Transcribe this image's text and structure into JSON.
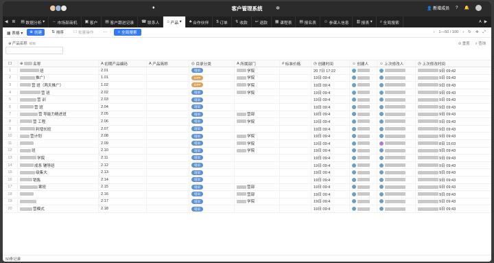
{
  "titlebar": {
    "title": "客户管理系统",
    "new_member": "新增成员"
  },
  "tabs": [
    {
      "label": "数据分析"
    },
    {
      "label": "市场部商机"
    },
    {
      "label": "客户"
    },
    {
      "label": "客户跟进记录"
    },
    {
      "label": "联系人"
    },
    {
      "label": "产品",
      "active": true
    },
    {
      "label": "合作伙伴"
    },
    {
      "label": "订单"
    },
    {
      "label": "收款"
    },
    {
      "label": "退款"
    },
    {
      "label": "课程表"
    },
    {
      "label": "报名表"
    },
    {
      "label": "参课人信息"
    },
    {
      "label": "报表"
    },
    {
      "label": "全局搜索"
    }
  ],
  "toolbar": {
    "view": "表格",
    "create": "创建",
    "sort": "排序",
    "batch": "批量操作",
    "more": "···",
    "search": "全局搜索",
    "pagination": "1—50 / 100"
  },
  "filter": {
    "label": "产品名称",
    "hint": "模糊",
    "query": "",
    "query_btn": "查询",
    "reset_btn": "重置"
  },
  "columns": {
    "name": "名称",
    "code": "初期产品编码",
    "short": "产品简称",
    "cat": "目录分类",
    "dept": "所属部门",
    "price": "标准价格",
    "ctime": "创建时间",
    "cby": "创建人",
    "mby": "上次修改人",
    "mtime": "上次修改时间"
  },
  "rows": [
    {
      "n": "1",
      "name": "班",
      "code": "2.01",
      "cat": "培训",
      "dept": "学院",
      "ctime": "20 7日 17:22",
      "mtime": "9日 09:42"
    },
    {
      "n": "2",
      "name": "推广）",
      "code": "1.01",
      "cat": "GFP",
      "dept": "学院",
      "ctime": "19日 09:4",
      "mtime": "9日 09:43"
    },
    {
      "n": "3",
      "name": "营 班（两天推广）",
      "code": "1.02",
      "cat": "GFP",
      "dept": "学院",
      "ctime": "19日 09:4",
      "mtime": "9日 09:43"
    },
    {
      "n": "4",
      "name": "营 班",
      "code": "2.02",
      "cat": "培训",
      "dept": "学院",
      "ctime": "19日 09:4",
      "mtime": "9日 09:43"
    },
    {
      "n": "5",
      "name": "营 训",
      "code": "2.03",
      "cat": "培训",
      "dept": "",
      "ctime": "19日 09:4",
      "mtime": "9日 09:43"
    },
    {
      "n": "6",
      "name": "营 班",
      "code": "2.04",
      "cat": "培训",
      "dept": "",
      "ctime": "19日 09:4",
      "mtime": "9日 09:43"
    },
    {
      "n": "7",
      "name": "营 导能力精进班",
      "code": "2.05",
      "cat": "培训",
      "dept": "营部",
      "ctime": "19日 09:4",
      "mtime": "9日 09:43"
    },
    {
      "n": "8",
      "name": "营 工程",
      "code": "2.06",
      "cat": "培训",
      "dept": "学院",
      "ctime": "19日 09:4",
      "mtime": "9日 09:43"
    },
    {
      "n": "9",
      "name": "利增长班",
      "code": "2.07",
      "cat": "培训",
      "dept": "",
      "ctime": "19日 09:4",
      "mtime": "9日 09:43"
    },
    {
      "n": "10",
      "name": "营计划",
      "code": "2.08",
      "cat": "培训",
      "dept": "学院",
      "ctime": "19日 09:4",
      "mtime": "9日 09:43"
    },
    {
      "n": "11",
      "name": "",
      "code": "2.09",
      "cat": "培训",
      "dept": "学院",
      "ctime": "19日 09:4",
      "mtime": "8日 15:03"
    },
    {
      "n": "12",
      "name": "班",
      "code": "2.10",
      "cat": "培训",
      "dept": "学院",
      "ctime": "19日 09:4",
      "mtime": "9日 09:43"
    },
    {
      "n": "13",
      "name": "学院",
      "code": "2.11",
      "cat": "培训",
      "dept": "",
      "ctime": "19日 09:4",
      "mtime": "9日 09:43"
    },
    {
      "n": "14",
      "name": "成系 辅导班",
      "code": "2.12",
      "cat": "培训",
      "dept": "",
      "ctime": "19日 09:4",
      "mtime": "9日 09:43"
    },
    {
      "n": "15",
      "name": "级集大",
      "code": "2.13",
      "cat": "培训",
      "dept": "",
      "ctime": "19日 09:4",
      "mtime": "9日 09:43"
    },
    {
      "n": "16",
      "name": "销售",
      "code": "2.14",
      "cat": "培训",
      "dept": "",
      "ctime": "19日 09:4",
      "mtime": "9日 09:43"
    },
    {
      "n": "17",
      "name": "案班",
      "code": "2.15",
      "cat": "培训",
      "dept": "营部",
      "ctime": "19日 09:4",
      "mtime": "9日 09:43"
    },
    {
      "n": "18",
      "name": "",
      "code": "2.16",
      "cat": "培训",
      "dept": "营部",
      "ctime": "19日 09:4",
      "mtime": "9日 09:43"
    },
    {
      "n": "19",
      "name": "",
      "code": "2.17",
      "cat": "培训",
      "dept": "学院",
      "ctime": "19日 09:4",
      "mtime": "9日 09:43"
    },
    {
      "n": "20",
      "name": "营模式",
      "code": "2.18",
      "cat": "培训",
      "dept": "",
      "ctime": "19日 09:4",
      "mtime": "9日 09:43"
    }
  ],
  "colors": {
    "accent": "#3478f6",
    "badge_train": "#5b8fd6",
    "badge_gfp": "#e0a25a"
  },
  "footer": {
    "count": "50条记录"
  }
}
